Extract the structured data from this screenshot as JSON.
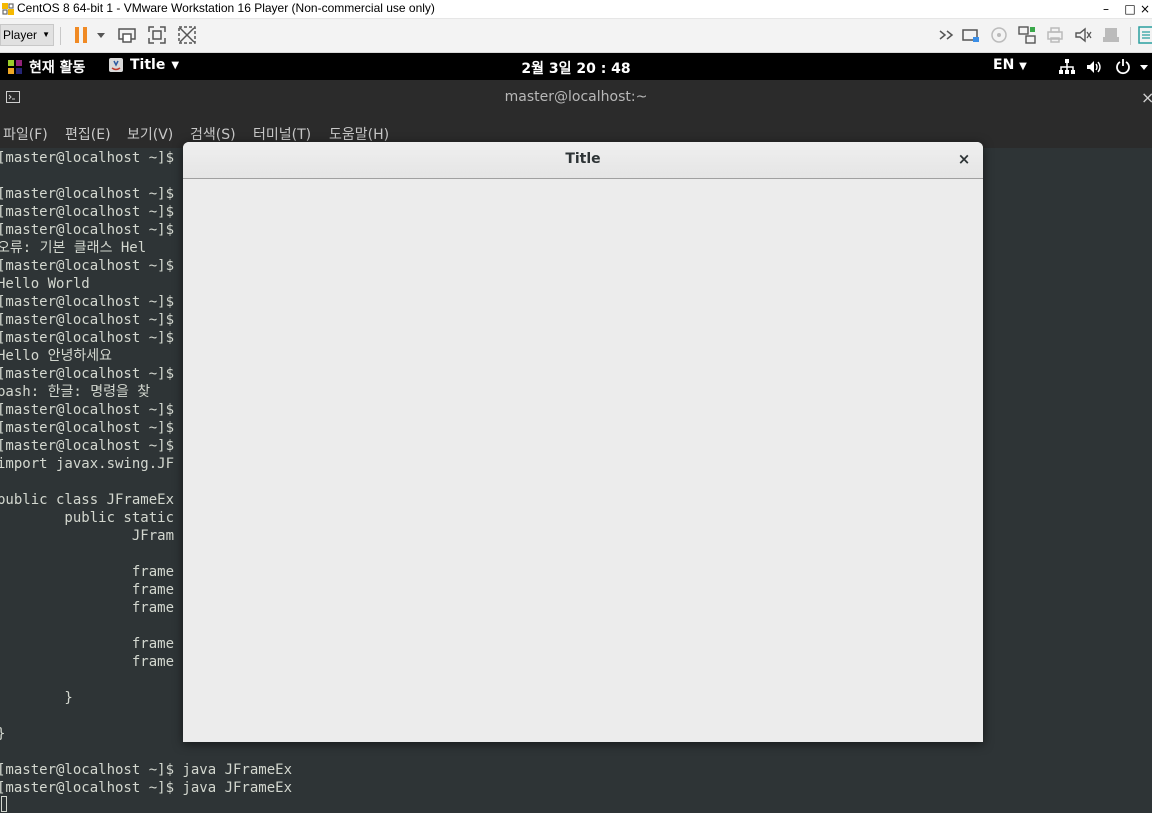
{
  "vmware": {
    "title": "CentOS 8 64-bit 1 - VMware Workstation 16 Player (Non-commercial use only)",
    "player_menu_label": "Player",
    "window_controls": {
      "minimize": "–",
      "maximize": "□",
      "close": "×"
    }
  },
  "gnome": {
    "activities_label": "현재 활동",
    "app_menu_label": "Title",
    "clock": "2월 3일  20 : 48",
    "language": "EN"
  },
  "terminal": {
    "title": "master@localhost:~",
    "close": "×",
    "menu": [
      "파일(F)",
      "편집(E)",
      "보기(V)",
      "검색(S)",
      "터미널(T)",
      "도움말(H)"
    ],
    "lines": [
      "[master@localhost ~]$",
      "",
      "[master@localhost ~]$",
      "[master@localhost ~]$",
      "[master@localhost ~]$",
      "오류: 기본 클래스 Hel",
      "[master@localhost ~]$",
      "Hello World",
      "[master@localhost ~]$",
      "[master@localhost ~]$",
      "[master@localhost ~]$",
      "Hello 안녕하세요",
      "[master@localhost ~]$",
      "bash: 한글: 명령을 찾",
      "[master@localhost ~]$",
      "[master@localhost ~]$",
      "[master@localhost ~]$",
      "import javax.swing.JF",
      "",
      "public class JFrameEx",
      "        public static",
      "                JFram",
      "",
      "                frame",
      "                frame",
      "                frame",
      "",
      "                frame",
      "                frame",
      "",
      "        }",
      "",
      "}",
      "",
      "[master@localhost ~]$ java JFrameEx",
      "[master@localhost ~]$ java JFrameEx"
    ]
  },
  "jframe": {
    "title": "Title",
    "close": "×"
  },
  "colors": {
    "terminal_bg": "#2e3436",
    "terminal_fg": "#d3d7cf",
    "header_bg": "#2b2b2b",
    "gnome_bar_bg": "#000000",
    "jframe_bg": "#ececec",
    "accent_orange": "#f08a24"
  }
}
